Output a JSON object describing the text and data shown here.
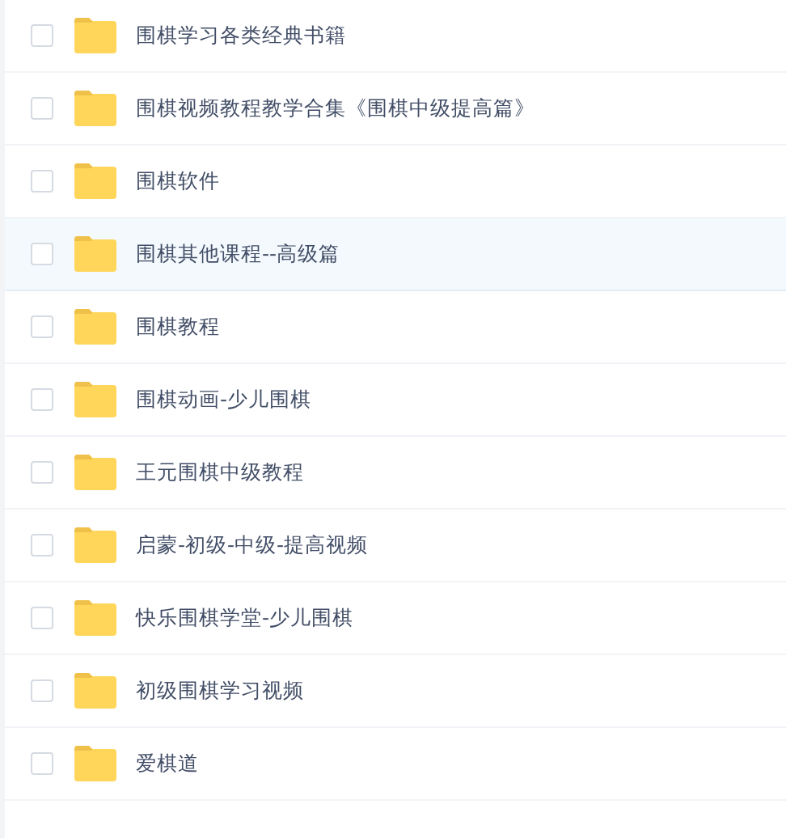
{
  "folders": [
    {
      "name": "围棋学习各类经典书籍",
      "checked": false,
      "highlighted": false
    },
    {
      "name": "围棋视频教程教学合集《围棋中级提高篇》",
      "checked": false,
      "highlighted": false
    },
    {
      "name": "围棋软件",
      "checked": false,
      "highlighted": false
    },
    {
      "name": "围棋其他课程--高级篇",
      "checked": false,
      "highlighted": true
    },
    {
      "name": "围棋教程",
      "checked": false,
      "highlighted": false
    },
    {
      "name": "围棋动画-少儿围棋",
      "checked": false,
      "highlighted": false
    },
    {
      "name": "王元围棋中级教程",
      "checked": false,
      "highlighted": false
    },
    {
      "name": "启蒙-初级-中级-提高视频",
      "checked": false,
      "highlighted": false
    },
    {
      "name": "快乐围棋学堂-少儿围棋",
      "checked": false,
      "highlighted": false
    },
    {
      "name": "初级围棋学习视频",
      "checked": false,
      "highlighted": false
    },
    {
      "name": "爱棋道",
      "checked": false,
      "highlighted": false
    }
  ]
}
